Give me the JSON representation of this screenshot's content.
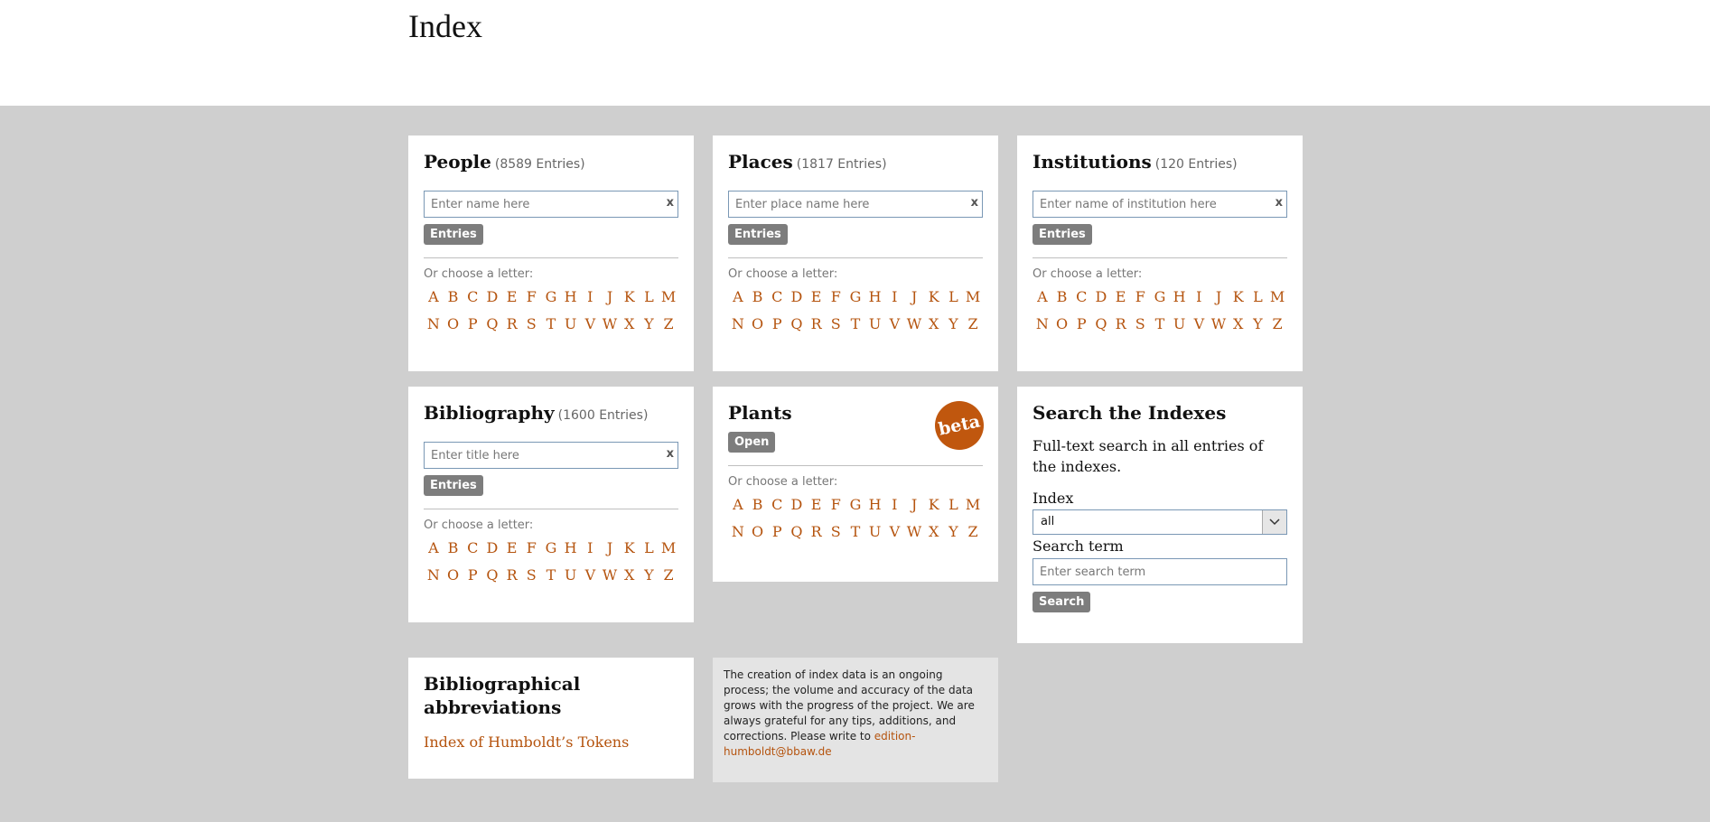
{
  "page": {
    "title": "Index"
  },
  "people": {
    "title": "People",
    "count": "(8589 Entries)",
    "placeholder": "Enter name here",
    "clear": "x",
    "button": "Entries",
    "choose": "Or choose a letter:"
  },
  "places": {
    "title": "Places",
    "count": "(1817 Entries)",
    "placeholder": "Enter place name here",
    "clear": "x",
    "button": "Entries",
    "choose": "Or choose a letter:"
  },
  "institutions": {
    "title": "Institutions",
    "count": "(120 Entries)",
    "placeholder": "Enter name of institution here",
    "clear": "x",
    "button": "Entries",
    "choose": "Or choose a letter:"
  },
  "bibliography": {
    "title": "Bibliography",
    "count": "(1600 Entries)",
    "placeholder": "Enter title here",
    "clear": "x",
    "button": "Entries",
    "choose": "Or choose a letter:"
  },
  "plants": {
    "title": "Plants",
    "badge": "beta",
    "button": "Open",
    "choose": "Or choose a letter:"
  },
  "search": {
    "title": "Search the Indexes",
    "description": "Full-text search in all entries of the indexes.",
    "index_label": "Index",
    "index_value": "all",
    "term_label": "Search term",
    "term_placeholder": "Enter search term",
    "button": "Search"
  },
  "abbrev": {
    "title": "Bibliographical abbreviations",
    "link": "Index of Humboldt’s Tokens"
  },
  "note": {
    "text": "The creation of index data is an ongoing process; the volume and accuracy of the data grows with the progress of the project. We are always grateful for any tips, additions, and corrections. Please write to ",
    "email": "edition-humboldt@bbaw.de"
  },
  "letters_row1": [
    "A",
    "B",
    "C",
    "D",
    "E",
    "F",
    "G",
    "H",
    "I",
    "J",
    "K",
    "L",
    "M"
  ],
  "letters_row2": [
    "N",
    "O",
    "P",
    "Q",
    "R",
    "S",
    "T",
    "U",
    "V",
    "W",
    "X",
    "Y",
    "Z"
  ],
  "colors": {
    "accent": "#b5540f",
    "button": "#7d7d7d",
    "background": "#cfcfcf"
  }
}
